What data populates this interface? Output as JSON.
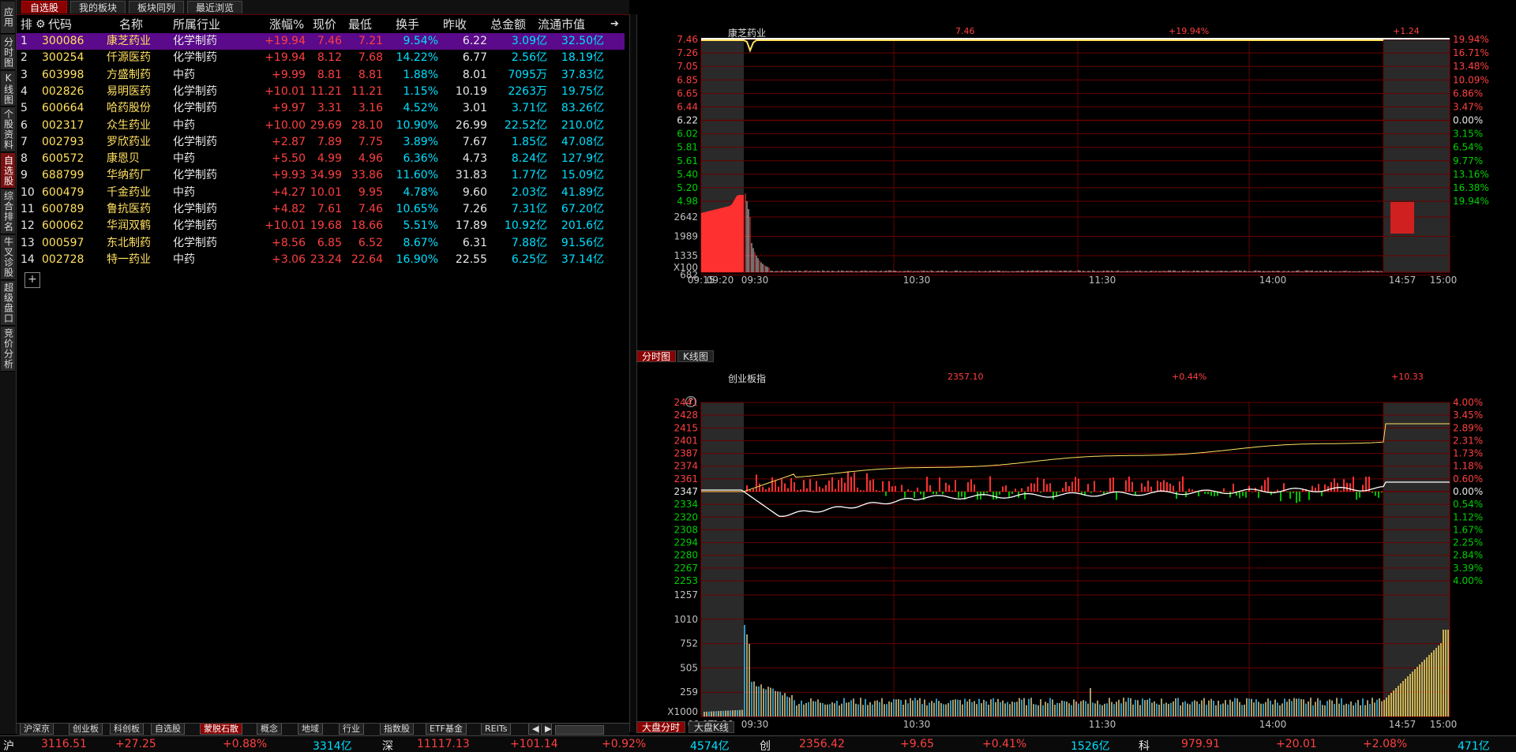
{
  "left_tabs": [
    {
      "label": "应用",
      "name": "app"
    },
    {
      "label": "分时图",
      "name": "intraday"
    },
    {
      "label": "K线图",
      "name": "kline"
    },
    {
      "label": "个股资料",
      "name": "stock-info"
    },
    {
      "label": "自选股",
      "name": "watchlist",
      "active": true
    },
    {
      "label": "综合排名",
      "name": "ranking"
    },
    {
      "label": "牛叉诊股",
      "name": "diagnosis"
    },
    {
      "label": "超级盘口",
      "name": "super-book"
    },
    {
      "label": "竞价分析",
      "name": "auction"
    }
  ],
  "top_tabs": [
    "自选股",
    "我的板块",
    "板块同列",
    "最近浏览"
  ],
  "table": {
    "headers": {
      "rank": "排",
      "code": "代码",
      "name": "名称",
      "industry": "所属行业",
      "chg": "涨幅%",
      "price": "现价",
      "low": "最低",
      "turnover": "换手",
      "prev": "昨收",
      "amount": "总金额",
      "mcap": "流通市值"
    },
    "rows": [
      {
        "rank": "1",
        "code": "300086",
        "name": "康芝药业",
        "industry": "化学制药",
        "chg": "+19.94",
        "price": "7.46",
        "low": "7.21",
        "turnover": "9.54%",
        "prev": "6.22",
        "amount": "3.09亿",
        "mcap": "32.50亿"
      },
      {
        "rank": "2",
        "code": "300254",
        "name": "仟源医药",
        "industry": "化学制药",
        "chg": "+19.94",
        "price": "8.12",
        "low": "7.68",
        "turnover": "14.22%",
        "prev": "6.77",
        "amount": "2.56亿",
        "mcap": "18.19亿"
      },
      {
        "rank": "3",
        "code": "603998",
        "name": "方盛制药",
        "industry": "中药",
        "chg": "+9.99",
        "price": "8.81",
        "low": "8.81",
        "turnover": "1.88%",
        "prev": "8.01",
        "amount": "7095万",
        "mcap": "37.83亿"
      },
      {
        "rank": "4",
        "code": "002826",
        "name": "易明医药",
        "industry": "化学制药",
        "chg": "+10.01",
        "price": "11.21",
        "low": "11.21",
        "turnover": "1.15%",
        "prev": "10.19",
        "amount": "2263万",
        "mcap": "19.75亿"
      },
      {
        "rank": "5",
        "code": "600664",
        "name": "哈药股份",
        "industry": "化学制药",
        "chg": "+9.97",
        "price": "3.31",
        "low": "3.16",
        "turnover": "4.52%",
        "prev": "3.01",
        "amount": "3.71亿",
        "mcap": "83.26亿"
      },
      {
        "rank": "6",
        "code": "002317",
        "name": "众生药业",
        "industry": "中药",
        "chg": "+10.00",
        "price": "29.69",
        "low": "28.10",
        "turnover": "10.90%",
        "prev": "26.99",
        "amount": "22.52亿",
        "mcap": "210.0亿"
      },
      {
        "rank": "7",
        "code": "002793",
        "name": "罗欣药业",
        "industry": "化学制药",
        "chg": "+2.87",
        "price": "7.89",
        "low": "7.75",
        "turnover": "3.89%",
        "prev": "7.67",
        "amount": "1.85亿",
        "mcap": "47.08亿"
      },
      {
        "rank": "8",
        "code": "600572",
        "name": "康恩贝",
        "industry": "中药",
        "chg": "+5.50",
        "price": "4.99",
        "low": "4.96",
        "turnover": "6.36%",
        "prev": "4.73",
        "amount": "8.24亿",
        "mcap": "127.9亿"
      },
      {
        "rank": "9",
        "code": "688799",
        "name": "华纳药厂",
        "industry": "化学制药",
        "chg": "+9.93",
        "price": "34.99",
        "low": "33.86",
        "turnover": "11.60%",
        "prev": "31.83",
        "amount": "1.77亿",
        "mcap": "15.09亿"
      },
      {
        "rank": "10",
        "code": "600479",
        "name": "千金药业",
        "industry": "中药",
        "chg": "+4.27",
        "price": "10.01",
        "low": "9.95",
        "turnover": "4.78%",
        "prev": "9.60",
        "amount": "2.03亿",
        "mcap": "41.89亿"
      },
      {
        "rank": "11",
        "code": "600789",
        "name": "鲁抗医药",
        "industry": "化学制药",
        "chg": "+4.82",
        "price": "7.61",
        "low": "7.46",
        "turnover": "10.65%",
        "prev": "7.26",
        "amount": "7.31亿",
        "mcap": "67.20亿"
      },
      {
        "rank": "12",
        "code": "600062",
        "name": "华润双鹤",
        "industry": "化学制药",
        "chg": "+10.01",
        "price": "19.68",
        "low": "18.66",
        "turnover": "5.51%",
        "prev": "17.89",
        "amount": "10.92亿",
        "mcap": "201.6亿"
      },
      {
        "rank": "13",
        "code": "000597",
        "name": "东北制药",
        "industry": "化学制药",
        "chg": "+8.56",
        "price": "6.85",
        "low": "6.52",
        "turnover": "8.67%",
        "prev": "6.31",
        "amount": "7.88亿",
        "mcap": "91.56亿"
      },
      {
        "rank": "14",
        "code": "002728",
        "name": "特一药业",
        "industry": "中药",
        "chg": "+3.06",
        "price": "23.24",
        "low": "22.64",
        "turnover": "16.90%",
        "prev": "22.55",
        "amount": "6.25亿",
        "mcap": "37.14亿"
      }
    ],
    "add_symbol": "+"
  },
  "bottom_tabs": [
    "沪深京",
    "创业板",
    "科创板",
    "自选股",
    "蒙脱石散",
    "概念",
    "地域",
    "行业",
    "指数股",
    "ETF基金",
    "REITs"
  ],
  "bottom_active": "蒙脱石散",
  "top_chart": {
    "name": "康芝药业",
    "price": "7.46",
    "pct": "+19.94%",
    "change": "+1.24",
    "price_labels": [
      "7.46",
      "7.26",
      "7.05",
      "6.85",
      "6.65",
      "6.44",
      "6.22",
      "6.02",
      "5.81",
      "5.61",
      "5.40",
      "5.20",
      "4.98"
    ],
    "pct_labels": [
      "19.94%",
      "16.71%",
      "13.48%",
      "10.09%",
      "6.86%",
      "3.47%",
      "0.00%",
      "3.15%",
      "6.54%",
      "9.77%",
      "13.16%",
      "16.38%",
      "19.94%"
    ],
    "vol_labels": [
      "2642",
      "1989",
      "1335",
      "682"
    ],
    "vol_unit": "X100",
    "time_labels": [
      "09:15",
      "09:20",
      "09:30",
      "10:30",
      "11:30",
      "14:00",
      "14:57",
      "15:00"
    ],
    "tabs": [
      "分时图",
      "K线图"
    ]
  },
  "bottom_chart": {
    "name": "创业板指",
    "price": "2357.10",
    "pct": "+0.44%",
    "change": "+10.33",
    "help": "?",
    "price_labels": [
      "2441",
      "2428",
      "2415",
      "2401",
      "2387",
      "2374",
      "2361",
      "2347",
      "2334",
      "2320",
      "2308",
      "2294",
      "2280",
      "2267",
      "2253"
    ],
    "pct_labels": [
      "4.00%",
      "3.45%",
      "2.89%",
      "2.31%",
      "1.73%",
      "1.18%",
      "0.60%",
      "0.00%",
      "0.54%",
      "1.12%",
      "1.67%",
      "2.25%",
      "2.84%",
      "3.39%",
      "4.00%"
    ],
    "vol_labels": [
      "1257",
      "1010",
      "752",
      "505",
      "259"
    ],
    "vol_unit": "X1000",
    "time_labels": [
      "09:15",
      "09:20",
      "09:30",
      "10:30",
      "11:30",
      "14:00",
      "14:57",
      "15:00"
    ],
    "tabs": [
      "大盘分时",
      "大盘K线"
    ]
  },
  "status": {
    "sh": {
      "label": "沪",
      "value": "3116.51",
      "change": "+27.25",
      "pct": "+0.88%",
      "amount": "3314亿"
    },
    "sz": {
      "label": "深",
      "value": "11117.13",
      "change": "+101.14",
      "pct": "+0.92%",
      "amount": "4574亿"
    },
    "cy": {
      "label": "创",
      "value": "2356.42",
      "change": "+9.65",
      "pct": "+0.41%",
      "amount": "1526亿"
    },
    "kc": {
      "label": "科",
      "value": "979.91",
      "change": "+20.01",
      "pct": "+2.08%",
      "amount": "471亿"
    }
  },
  "colors": {
    "up": "#ff4040",
    "down": "#00d000",
    "accent": "#8b0000",
    "selected_row": "#5a0a8a",
    "grid": "#8b0000"
  }
}
